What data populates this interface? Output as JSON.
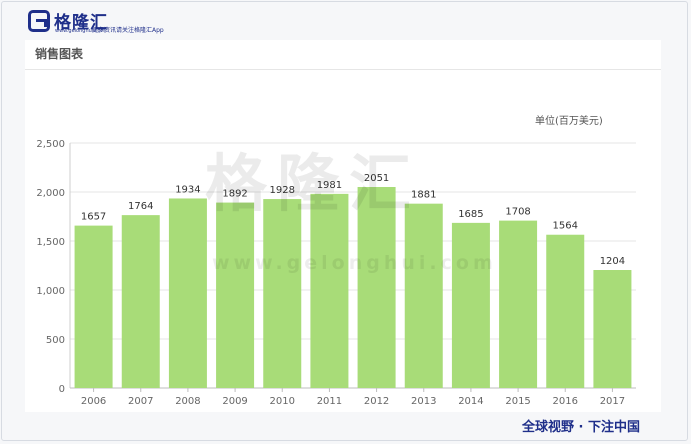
{
  "header": {
    "brand_name": "格隆汇",
    "brand_domain": "www.gelonghui.com",
    "slogan": "更多资讯请关注格隆汇App"
  },
  "panel": {
    "title": "销售图表"
  },
  "watermark": {
    "text": "格隆汇",
    "url": "www.gelonghui.com"
  },
  "footer": {
    "text": "全球视野 · 下注中国"
  },
  "chart_data": {
    "type": "bar",
    "categories": [
      "2006",
      "2007",
      "2008",
      "2009",
      "2010",
      "2011",
      "2012",
      "2013",
      "2014",
      "2015",
      "2016",
      "2017"
    ],
    "values": [
      1657,
      1764,
      1934,
      1892,
      1928,
      1981,
      2051,
      1881,
      1685,
      1708,
      1564,
      1204
    ],
    "title": "",
    "unit_label": "单位(百万美元)",
    "xlabel": "",
    "ylabel": "",
    "ylim": [
      0,
      2500
    ],
    "yticks": [
      0,
      500,
      1000,
      1500,
      2000,
      2500
    ],
    "ytick_labels": [
      "0",
      "500",
      "1,000",
      "1,500",
      "2,000",
      "2,500"
    ],
    "grid": true,
    "bar_color": "#a8dc78"
  }
}
